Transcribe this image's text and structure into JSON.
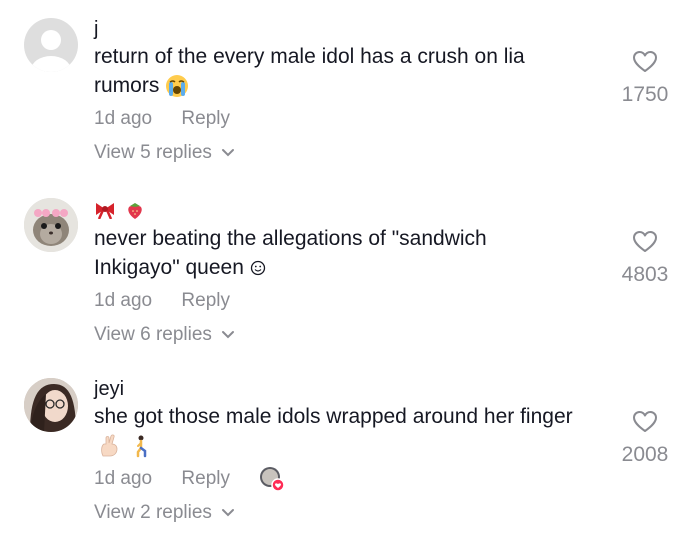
{
  "comments": [
    {
      "username": "j",
      "text": "return of the every male idol has a crush on lia rumors",
      "time": "1d ago",
      "reply_label": "Reply",
      "view_replies": "View 5 replies",
      "likes": "1750",
      "avatar": "default-avatar-icon"
    },
    {
      "username": "",
      "username_emojis": [
        "bow-emoji",
        "strawberry-emoji"
      ],
      "text": "never beating the allegations of \"sandwich Inkigayo\" queen",
      "time": "1d ago",
      "reply_label": "Reply",
      "view_replies": "View 6 replies",
      "likes": "4803",
      "avatar": "hamster-avatar"
    },
    {
      "username": "jeyi",
      "text": "she got those male idols wrapped around her finger",
      "time": "1d ago",
      "reply_label": "Reply",
      "view_replies": "View 2 replies",
      "likes": "2008",
      "avatar": "girl-photo-avatar"
    }
  ],
  "colors": {
    "text": "#161823",
    "muted": "#8a8b91",
    "heart_badge": "#fe2c55"
  }
}
